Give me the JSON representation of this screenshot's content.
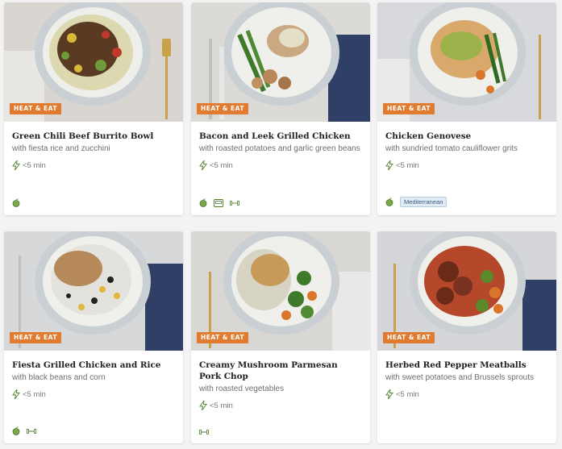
{
  "meals": [
    {
      "badge": "HEAT & EAT",
      "title": "Green Chili Beef Burrito Bowl",
      "subtitle": "with fiesta rice and zucchini",
      "time": "<5 min",
      "tags": [
        "apple-icon"
      ]
    },
    {
      "badge": "HEAT & EAT",
      "title": "Bacon and Leek Grilled Chicken",
      "subtitle": "with roasted potatoes and garlic green beans",
      "time": "<5 min",
      "tags": [
        "apple-icon",
        "scale-icon",
        "dumbbell-icon"
      ]
    },
    {
      "badge": "HEAT & EAT",
      "title": "Chicken Genovese",
      "subtitle": "with sundried tomato cauliflower grits",
      "time": "<5 min",
      "tags": [
        "apple-icon"
      ],
      "tag_label": "Mediterranean"
    },
    {
      "badge": "HEAT & EAT",
      "title": "Fiesta Grilled Chicken and Rice",
      "subtitle": "with black beans and corn",
      "time": "<5 min",
      "tags": [
        "apple-icon",
        "dumbbell-icon"
      ]
    },
    {
      "badge": "HEAT & EAT",
      "title": "Creamy Mushroom Parmesan Pork Chop",
      "subtitle": "with roasted vegetables",
      "time": "<5 min",
      "tags": [
        "dumbbell-icon"
      ]
    },
    {
      "badge": "HEAT & EAT",
      "title": "Herbed Red Pepper Meatballs",
      "subtitle": "with sweet potatoes and Brussels sprouts",
      "time": "<5 min",
      "tags": []
    }
  ],
  "colors": {
    "badge": "#e07b2f",
    "icon_green": "#6a9a3a",
    "pill_bg": "#e1ebf6"
  }
}
